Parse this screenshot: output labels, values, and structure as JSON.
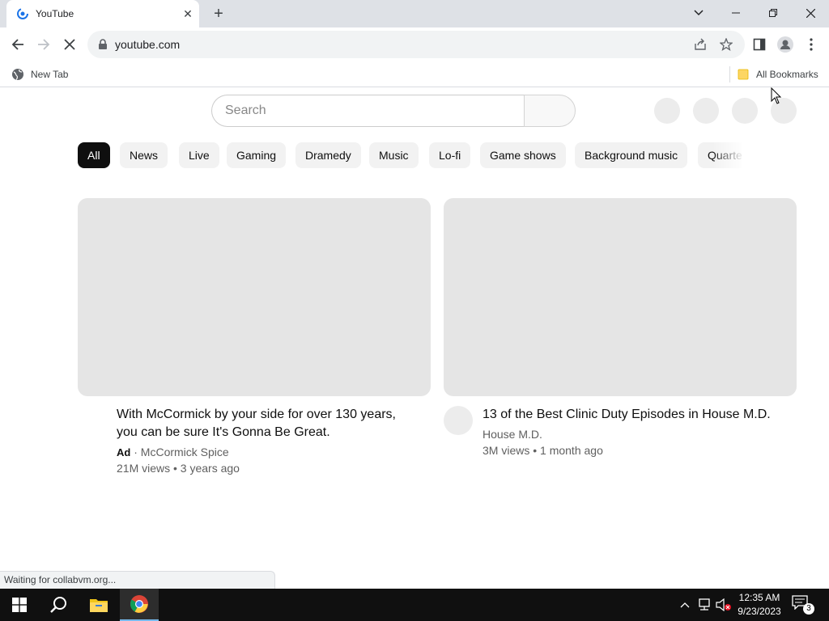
{
  "browser": {
    "tab": {
      "title": "YouTube",
      "close_glyph": "✕"
    },
    "new_tab_glyph": "+",
    "window_controls": [
      "chevron-down",
      "minimize",
      "restore",
      "close"
    ],
    "address": {
      "url": "youtube.com"
    },
    "bookmarks": {
      "new_tab": "New Tab",
      "all_bookmarks": "All Bookmarks"
    },
    "status_text": "Waiting for collabvm.org..."
  },
  "youtube": {
    "search": {
      "placeholder": "Search"
    },
    "chips": [
      {
        "label": "All",
        "active": true
      },
      {
        "label": "News"
      },
      {
        "label": "Live"
      },
      {
        "label": "Gaming"
      },
      {
        "label": "Dramedy"
      },
      {
        "label": "Music"
      },
      {
        "label": "Lo-fi"
      },
      {
        "label": "Game shows"
      },
      {
        "label": "Background music"
      },
      {
        "label": "Quarte"
      }
    ],
    "videos": [
      {
        "title": "With McCormick by your side for over 130 years, you can be sure It's Gonna Be Great.",
        "ad_label": "Ad",
        "channel": "McCormick Spice",
        "stats": "21M views • 3 years ago"
      },
      {
        "title": "13 of the Best Clinic Duty Episodes in House M.D.",
        "channel": "House M.D.",
        "stats": "3M views • 1 month ago"
      }
    ]
  },
  "taskbar": {
    "time": "12:35 AM",
    "date": "9/23/2023",
    "notification_count": "3"
  },
  "colors": {
    "chip_active_bg": "#0f0f0f",
    "chip_bg": "#f2f2f2",
    "placeholder_gray": "#e5e5e5",
    "taskbar_bg": "#101010"
  }
}
